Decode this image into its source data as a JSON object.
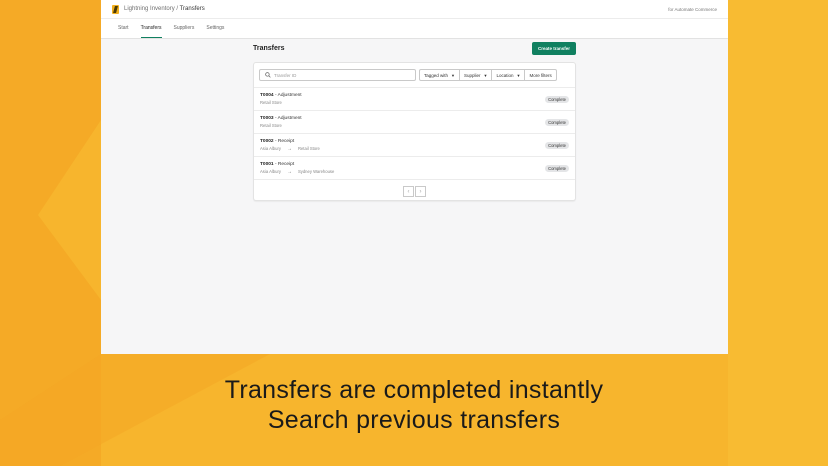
{
  "app": {
    "name": "Lightning Inventory",
    "separator": "/",
    "section": "Transfers",
    "for_text": "for Automate Commerce"
  },
  "nav": {
    "tabs": [
      {
        "label": "Start"
      },
      {
        "label": "Transfers"
      },
      {
        "label": "Suppliers"
      },
      {
        "label": "Settings"
      }
    ]
  },
  "page": {
    "title": "Transfers",
    "create_label": "Create transfer"
  },
  "filters": {
    "search_placeholder": "Transfer ID",
    "tagged_with": "Tagged with",
    "supplier": "Supplier",
    "location": "Location",
    "more_filters": "More filters"
  },
  "transfers": [
    {
      "id": "T0004",
      "type": "- Adjustment",
      "from": "Retail Store",
      "to": "",
      "status": "Complete"
    },
    {
      "id": "T0003",
      "type": "- Adjustment",
      "from": "Retail Store",
      "to": "",
      "status": "Complete"
    },
    {
      "id": "T0002",
      "type": "- Receipt",
      "from": "Asia Albury",
      "to": "Retail Store",
      "status": "Complete"
    },
    {
      "id": "T0001",
      "type": "- Receipt",
      "from": "Asia Albury",
      "to": "Sydney Warehouse",
      "status": "Complete"
    }
  ],
  "pager": {
    "prev": "‹",
    "next": "›"
  },
  "caption": {
    "line1": "Transfers are completed instantly",
    "line2": "Search previous transfers"
  },
  "colors": {
    "background": "#f7b52d",
    "accent": "#108060"
  },
  "icons": {
    "search": "search-icon",
    "logo": "lightning-logo-icon",
    "arrow": "arrow-right-icon",
    "caret": "caret-down-icon"
  }
}
